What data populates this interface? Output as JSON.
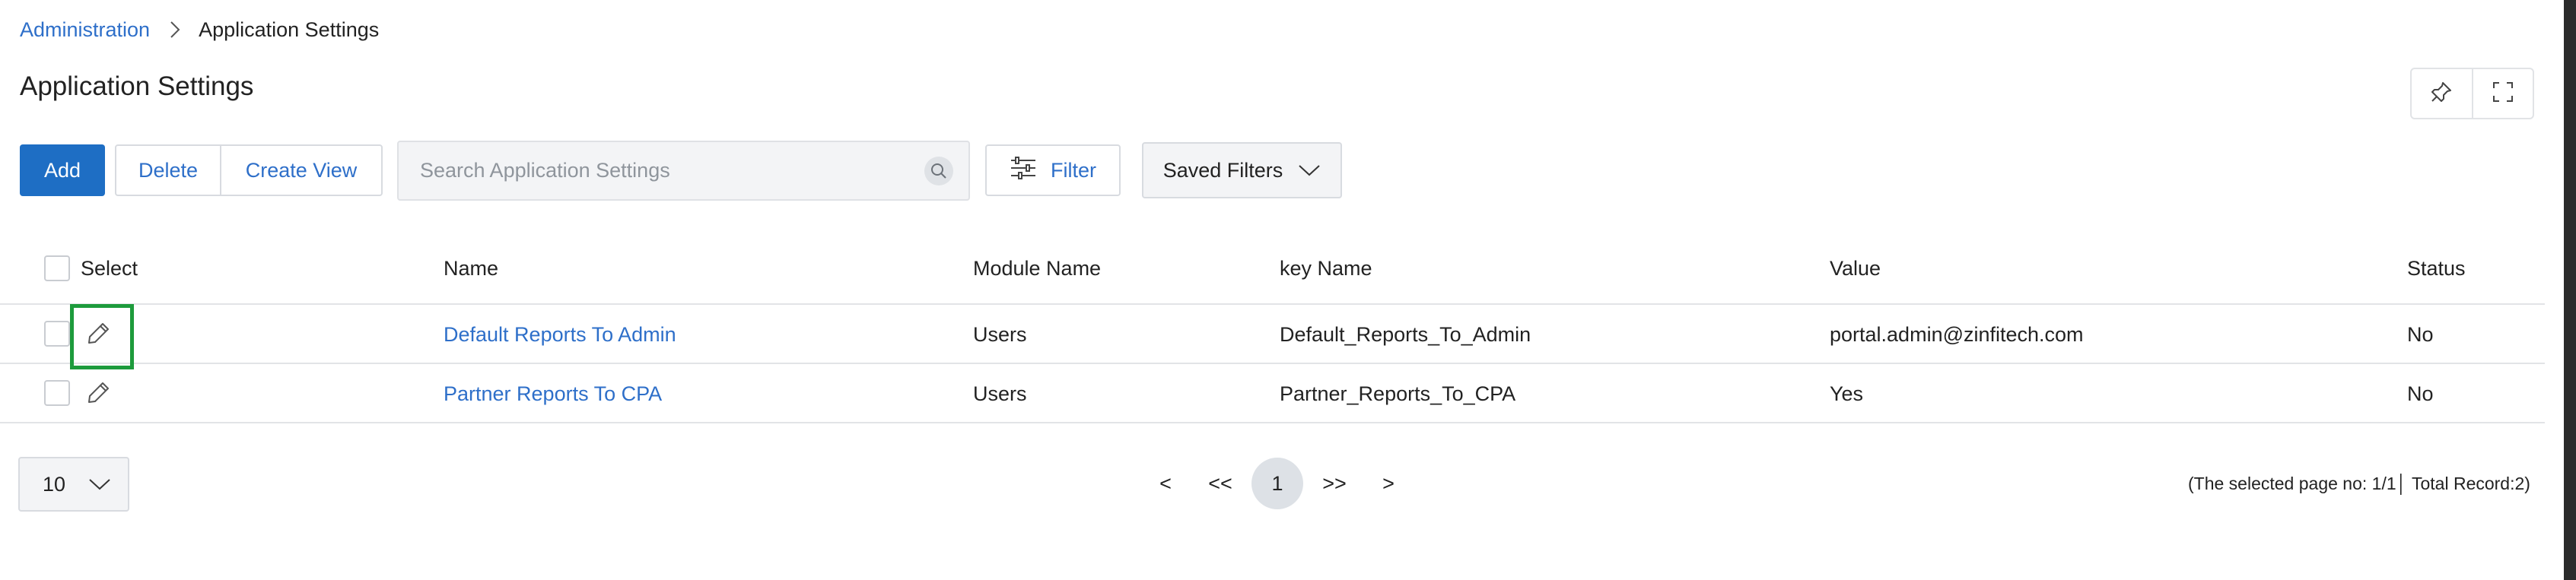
{
  "breadcrumb": {
    "parent": "Administration",
    "current": "Application Settings"
  },
  "page_title": "Application Settings",
  "toolbar": {
    "add_label": "Add",
    "delete_label": "Delete",
    "create_view_label": "Create View",
    "search_placeholder": "Search Application Settings",
    "search_value": "",
    "filter_label": "Filter",
    "saved_filters_label": "Saved Filters"
  },
  "table": {
    "columns": {
      "select": "Select",
      "name": "Name",
      "module": "Module Name",
      "key": "key Name",
      "value": "Value",
      "status": "Status"
    },
    "rows": [
      {
        "name": "Default Reports To Admin",
        "module": "Users",
        "key": "Default_Reports_To_Admin",
        "value": "portal.admin@zinfitech.com",
        "status": "No"
      },
      {
        "name": "Partner Reports To CPA",
        "module": "Users",
        "key": "Partner_Reports_To_CPA",
        "value": "Yes",
        "status": "No"
      }
    ]
  },
  "pagination": {
    "page_size": "10",
    "prev": "<",
    "first": "<<",
    "current": "1",
    "last": ">>",
    "next": ">",
    "record_info": "(The selected page no: 1/1│ Total Record:2)"
  },
  "icons": {
    "breadcrumb_separator": "chevron-right-icon",
    "pin": "pin-icon",
    "fullscreen": "fullscreen-icon",
    "search": "search-icon",
    "filter": "sliders-icon",
    "dropdown": "chevron-down-icon",
    "edit": "pencil-icon"
  },
  "colors": {
    "primary": "#1e6ec4",
    "link": "#2e6fc9",
    "highlight": "#1d9b3c"
  }
}
